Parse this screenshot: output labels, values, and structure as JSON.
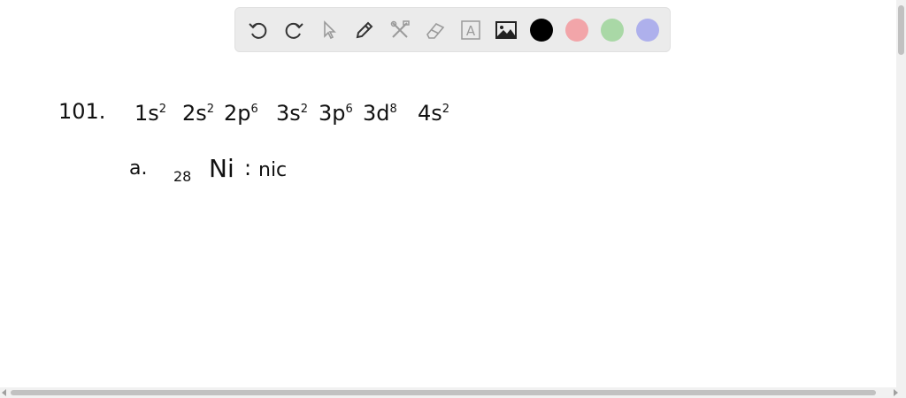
{
  "toolbar": {
    "tools": [
      {
        "name": "undo",
        "icon": "undo-icon"
      },
      {
        "name": "redo",
        "icon": "redo-icon"
      },
      {
        "name": "select",
        "icon": "pointer-icon"
      },
      {
        "name": "pen",
        "icon": "pen-icon"
      },
      {
        "name": "tools",
        "icon": "tools-icon"
      },
      {
        "name": "eraser",
        "icon": "eraser-icon"
      },
      {
        "name": "text",
        "icon": "text-box-icon",
        "label": "A"
      },
      {
        "name": "image",
        "icon": "image-icon"
      }
    ],
    "colors": [
      "#000000",
      "#f2a5a9",
      "#a9d8a6",
      "#aeb0ec"
    ]
  },
  "canvas": {
    "problem_number": "101.",
    "configuration": [
      {
        "base": "1s",
        "exp": "2"
      },
      {
        "base": "2s",
        "exp": "2"
      },
      {
        "base": "2p",
        "exp": "6"
      },
      {
        "base": "3s",
        "exp": "2"
      },
      {
        "base": "3p",
        "exp": "6"
      },
      {
        "base": "3d",
        "exp": "8"
      },
      {
        "base": "4s",
        "exp": "2"
      }
    ],
    "part_label": "a.",
    "atomic_number": "28",
    "element_symbol": "Ni",
    "separator": ":",
    "element_name_partial": "nic"
  }
}
